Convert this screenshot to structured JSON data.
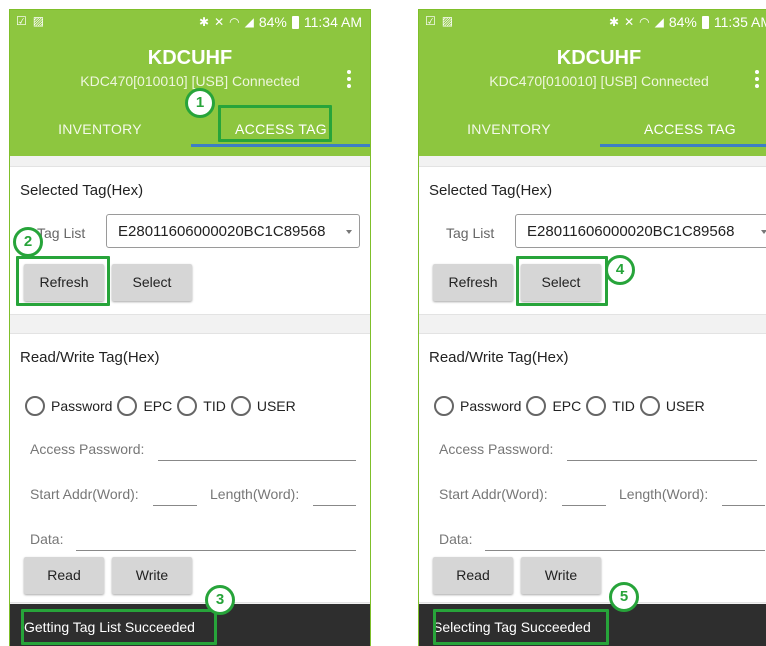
{
  "colors": {
    "app_bar": "#8dc63f",
    "tab_indicator": "#3d7ec4",
    "callout": "#27a43a",
    "toast_bg": "#2e2e2e"
  },
  "icons": [
    "checkbox-icon",
    "image-icon",
    "bluetooth-icon",
    "mute-icon",
    "wifi-icon",
    "signal-icon",
    "battery-icon",
    "overflow-menu-icon"
  ],
  "screens": [
    {
      "status": {
        "battery": "84%",
        "time": "11:34 AM"
      },
      "app": {
        "title": "KDCUHF",
        "subtitle": "KDC470[010010] [USB] Connected"
      },
      "tabs": [
        "INVENTORY",
        "ACCESS TAG"
      ],
      "selected_tag": {
        "title": "Selected Tag(Hex)",
        "tag_list_label": "Tag List",
        "tag_value": "E28011606000020BC1C89568",
        "refresh": "Refresh",
        "select": "Select"
      },
      "rw": {
        "title": "Read/Write Tag(Hex)",
        "options": [
          "Password",
          "EPC",
          "TID",
          "USER"
        ],
        "access_password": "Access Password:",
        "start_addr": "Start Addr(Word):",
        "length": "Length(Word):",
        "data": "Data:",
        "read": "Read",
        "write": "Write"
      },
      "toast": "Getting Tag List Succeeded",
      "callouts": [
        "1",
        "2",
        "3"
      ]
    },
    {
      "status": {
        "battery": "84%",
        "time": "11:35 AM"
      },
      "app": {
        "title": "KDCUHF",
        "subtitle": "KDC470[010010] [USB] Connected"
      },
      "tabs": [
        "INVENTORY",
        "ACCESS TAG"
      ],
      "selected_tag": {
        "title": "Selected Tag(Hex)",
        "tag_list_label": "Tag List",
        "tag_value": "E28011606000020BC1C89568",
        "refresh": "Refresh",
        "select": "Select"
      },
      "rw": {
        "title": "Read/Write Tag(Hex)",
        "options": [
          "Password",
          "EPC",
          "TID",
          "USER"
        ],
        "access_password": "Access Password:",
        "start_addr": "Start Addr(Word):",
        "length": "Length(Word):",
        "data": "Data:",
        "read": "Read",
        "write": "Write"
      },
      "toast": "Selecting Tag Succeeded",
      "callouts": [
        "4",
        "5"
      ]
    }
  ]
}
